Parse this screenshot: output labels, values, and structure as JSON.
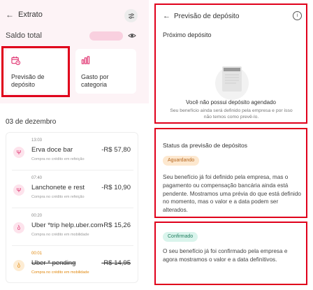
{
  "left": {
    "header": {
      "title": "Extrato"
    },
    "saldo_label": "Saldo total",
    "cards": [
      {
        "label": "Previsão de depósito",
        "icon": "calendar-clock-icon"
      },
      {
        "label": "Gasto por categoria",
        "icon": "bar-chart-icon"
      }
    ],
    "date_header": "03 de dezembro",
    "transactions": [
      {
        "time": "13:03",
        "name": "Erva doce bar",
        "amount": "-R$ 57,80",
        "sub": "Compra no crédito em refeição",
        "category": "refeicao"
      },
      {
        "time": "07:40",
        "name": "Lanchonete e rest",
        "amount": "-R$ 10,90",
        "sub": "Compra no crédito em refeição",
        "category": "refeicao"
      },
      {
        "time": "00:20",
        "name": "Uber *trip help.uber.com",
        "amount": "-R$ 15,26",
        "sub": "Compra no crédito em mobilidade",
        "category": "mobilidade"
      },
      {
        "time": "00:01",
        "name": "Uber * pending",
        "amount": "-R$ 14,95",
        "sub": "Compra no crédito em mobilidade",
        "category": "mobilidade-pending"
      }
    ]
  },
  "forecast": {
    "title": "Previsão de depósito",
    "subtitle": "Próximo depósito",
    "empty_title": "Você não possui depósito agendado",
    "empty_desc": "Seu benefício ainda será definido pela empresa e por isso não temos como prevê-lo."
  },
  "status": {
    "title": "Status da previsão de depósitos",
    "waiting_chip": "Aguardando",
    "waiting_text": "Seu benefício já foi definido pela empresa, mas o pagamento ou compensação bancária ainda está pendente. Mostramos uma prévia do que está definido no momento, mas o valor e a data podem ser alterados.",
    "confirmed_chip": "Confirmado",
    "confirmed_text": "O seu benefício já foi confirmado pela empresa e agora mostramos o valor e a data definitivos."
  },
  "colors": {
    "accent": "#e0316f",
    "highlight": "#e0001b",
    "pending": "#e0870c"
  }
}
